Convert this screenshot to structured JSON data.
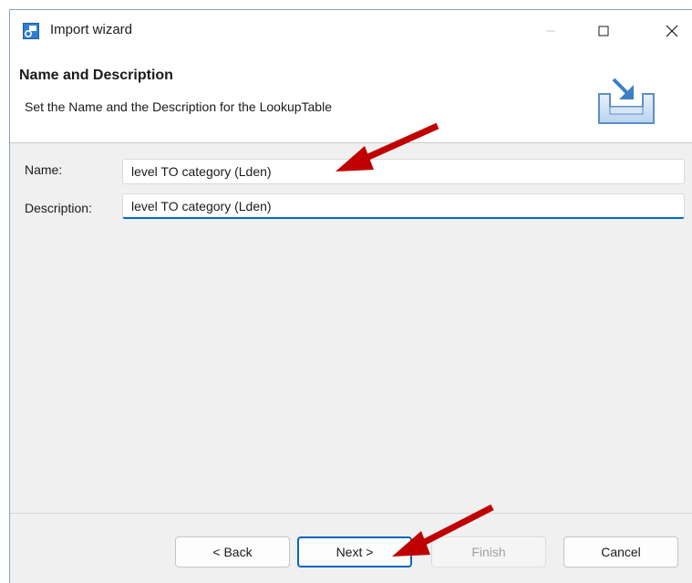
{
  "window": {
    "title": "Import wizard"
  },
  "header": {
    "title": "Name and Description",
    "description": "Set the Name and the Description for the LookupTable"
  },
  "form": {
    "name_label": "Name:",
    "name_value": "level TO category (Lden)",
    "description_label": "Description:",
    "description_value": "level TO category (Lden)"
  },
  "buttons": {
    "back": "< Back",
    "next": "Next >",
    "finish": "Finish",
    "cancel": "Cancel"
  },
  "annotation": {
    "arrow_color": "#c00000"
  },
  "colors": {
    "focus_accent": "#0067c0"
  }
}
